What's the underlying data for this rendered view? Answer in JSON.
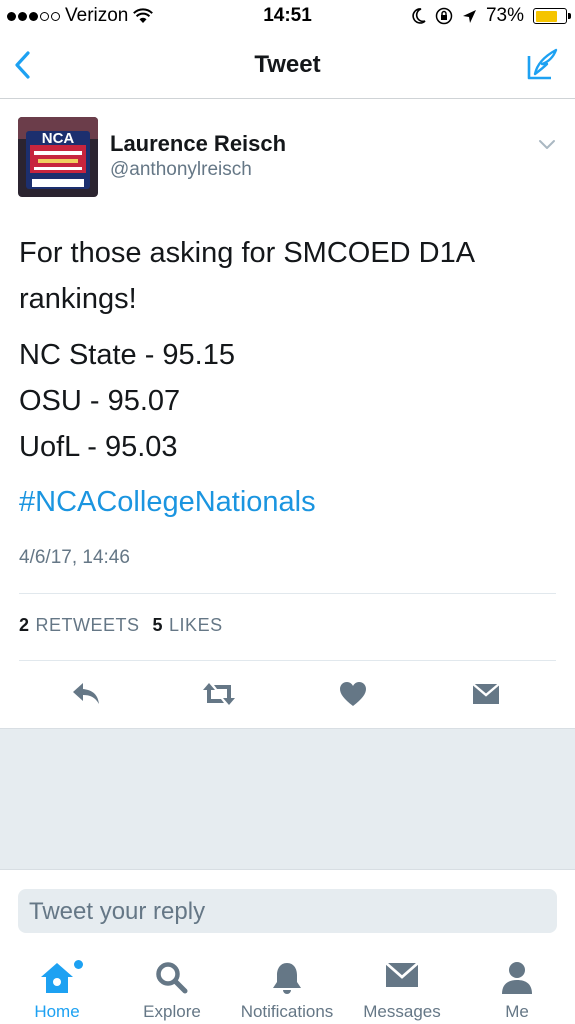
{
  "status_bar": {
    "carrier": "Verizon",
    "time": "14:51",
    "battery": "73%",
    "battery_level": 0.73,
    "signal_bars_filled": 3,
    "signal_bars_total": 5
  },
  "nav": {
    "title": "Tweet",
    "accent_color": "#1da1f2"
  },
  "tweet": {
    "author_name": "Laurence Reisch",
    "author_handle": "@anthonylreisch",
    "avatar_text": "NCA",
    "text_lines": [
      "For those asking for SMCOED D1A",
      "rankings!"
    ],
    "rankings": [
      "NC State - 95.15",
      "OSU - 95.07",
      "UofL - 95.03"
    ],
    "hashtag": "#NCACollegeNationals",
    "timestamp": "4/6/17, 14:46",
    "retweets_count": "2",
    "retweets_label": "RETWEETS",
    "likes_count": "5",
    "likes_label": "LIKES"
  },
  "reply": {
    "placeholder": "Tweet your reply"
  },
  "tabs": [
    {
      "label": "Home",
      "icon": "home-icon",
      "active": true
    },
    {
      "label": "Explore",
      "icon": "search-icon",
      "active": false
    },
    {
      "label": "Notifications",
      "icon": "bell-icon",
      "active": false
    },
    {
      "label": "Messages",
      "icon": "envelope-icon",
      "active": false
    },
    {
      "label": "Me",
      "icon": "person-icon",
      "active": false
    }
  ],
  "colors": {
    "link": "#1b95e0",
    "icon_gray": "#657786",
    "background_gray": "#e6ecf0"
  }
}
